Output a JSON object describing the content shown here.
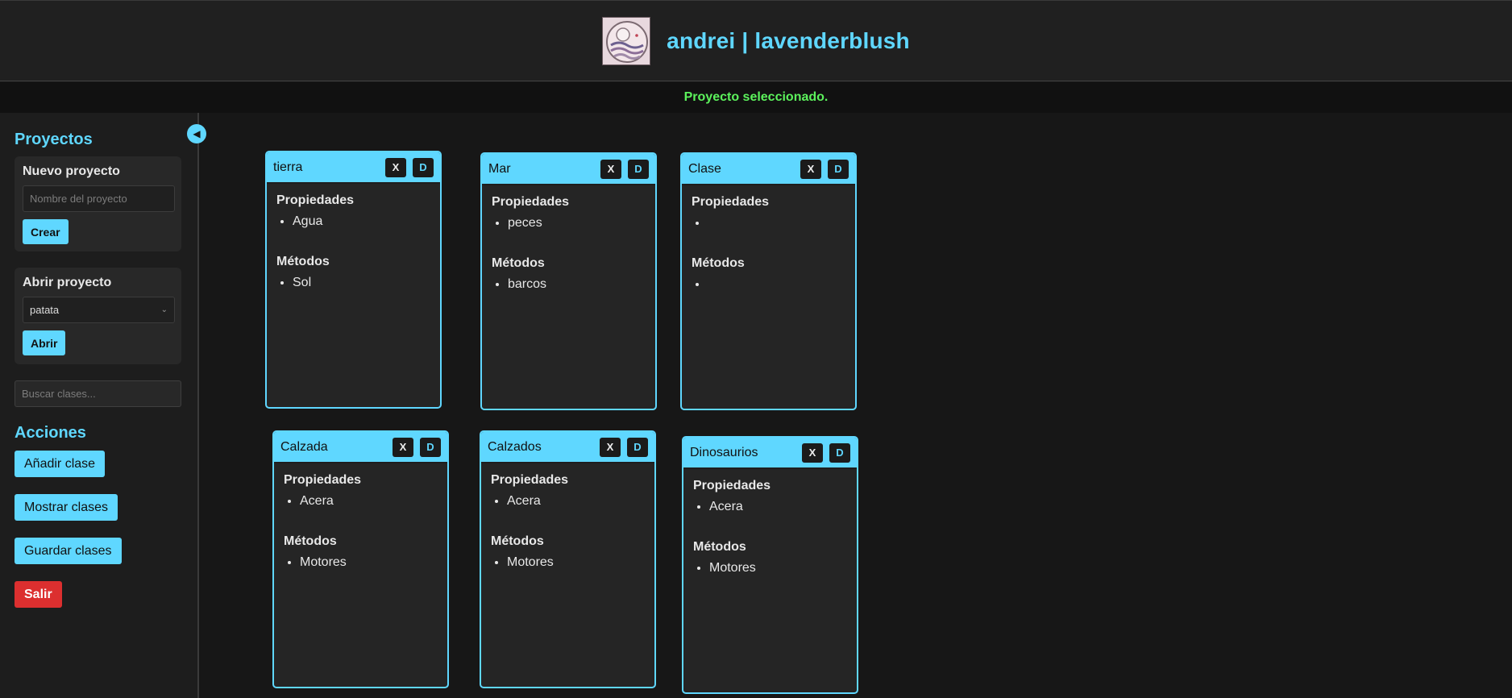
{
  "header": {
    "title": "andrei | lavenderblush"
  },
  "status_message": "Proyecto seleccionado.",
  "sidebar": {
    "projects_title": "Proyectos",
    "new_project": {
      "title": "Nuevo proyecto",
      "placeholder": "Nombre del proyecto",
      "button": "Crear"
    },
    "open_project": {
      "title": "Abrir proyecto",
      "selected": "patata",
      "button": "Abrir"
    },
    "search_placeholder": "Buscar clases...",
    "actions_title": "Acciones",
    "actions": {
      "add": "Añadir clase",
      "show": "Mostrar clases",
      "save": "Guardar clases",
      "exit": "Salir"
    }
  },
  "card_labels": {
    "properties": "Propiedades",
    "methods": "Métodos",
    "delete": "X",
    "duplicate": "D"
  },
  "classes": [
    {
      "name": "tierra",
      "properties": [
        "Agua"
      ],
      "methods": [
        "Sol"
      ]
    },
    {
      "name": "Mar",
      "properties": [
        "peces"
      ],
      "methods": [
        "barcos"
      ]
    },
    {
      "name": "Clase",
      "properties": [
        ""
      ],
      "methods": [
        ""
      ]
    },
    {
      "name": "Calzada",
      "properties": [
        "Acera"
      ],
      "methods": [
        "Motores"
      ]
    },
    {
      "name": "Calzados",
      "properties": [
        "Acera"
      ],
      "methods": [
        "Motores"
      ]
    },
    {
      "name": "Dinosaurios",
      "properties": [
        "Acera"
      ],
      "methods": [
        "Motores"
      ]
    }
  ],
  "colors": {
    "accent": "#5fd7ff",
    "status": "#5cf25c",
    "danger": "#dc2f2f"
  }
}
